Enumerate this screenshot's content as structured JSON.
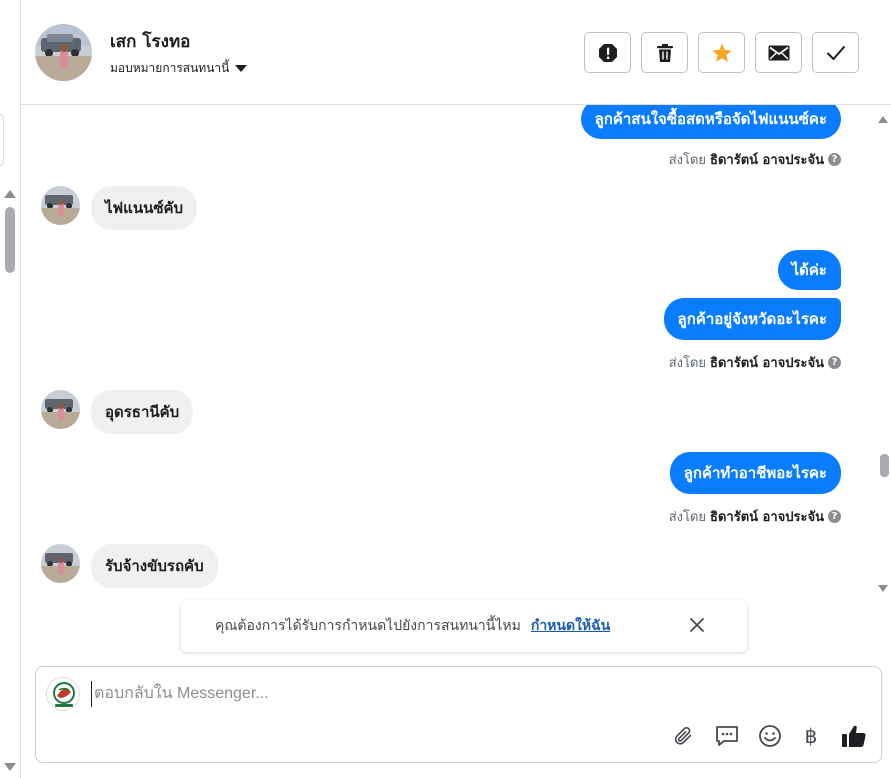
{
  "header": {
    "contact_name": "เสก โรงทอ",
    "assign_label": "มอบหมายการสนทนานี้",
    "actions": [
      {
        "name": "report-button",
        "icon": "exclamation-icon"
      },
      {
        "name": "delete-button",
        "icon": "trash-icon"
      },
      {
        "name": "star-button",
        "icon": "star-icon"
      },
      {
        "name": "mark-unread-button",
        "icon": "envelope-icon"
      },
      {
        "name": "mark-done-button",
        "icon": "check-icon"
      }
    ]
  },
  "messages": {
    "m1": "ลูกค้าสนใจซื้อสดหรือจัดไฟแนนซ์คะ",
    "m2": "ไฟแนนซ์คับ",
    "m3": "ได้ค่ะ",
    "m4": "ลูกค้าอยู่จังหวัดอะไรคะ",
    "m5": "อุดรธานีคับ",
    "m6": "ลูกค้าทำอาชีพอะไรคะ",
    "m7": "รับจ้างขับรถคับ"
  },
  "sent_by": {
    "prefix": "ส่งโดย",
    "agent": "ธิดารัตน์ อาจประจัน",
    "help_glyph": "?"
  },
  "prompt": {
    "text": "คุณต้องการได้รับการกำหนดไปยังการสนทนานี้ไหม",
    "link": "กำหนดให้ฉัน"
  },
  "composer": {
    "placeholder": "ตอบกลับใน Messenger...",
    "tools": [
      "paperclip-icon",
      "saved-reply-icon",
      "emoji-icon",
      "baht-icon",
      "thumbs-up-icon"
    ],
    "baht_glyph": "฿"
  },
  "colors": {
    "accent": "#0a7cff",
    "star": "#f5a623",
    "link": "#1a5db5",
    "bubble_in": "#f0f0f0"
  }
}
